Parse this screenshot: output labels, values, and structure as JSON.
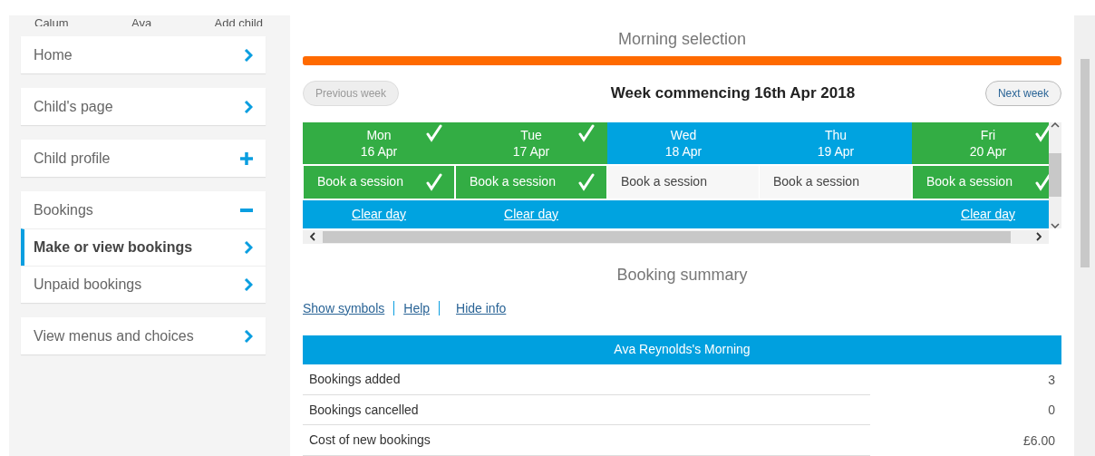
{
  "child_tabs": [
    "Calum",
    "Ava",
    "Add child"
  ],
  "sidebar": {
    "items": [
      {
        "label": "Home",
        "kind": "link",
        "selected": false
      },
      {
        "label": "Child's page",
        "kind": "link",
        "selected": false
      },
      {
        "label": "Child profile",
        "kind": "group",
        "expanded": false,
        "selected": false
      },
      {
        "label": "Bookings",
        "kind": "group",
        "expanded": true,
        "selected": false,
        "children": [
          {
            "label": "Make or view bookings",
            "kind": "link",
            "selected": true
          },
          {
            "label": "Unpaid bookings",
            "kind": "link",
            "selected": false
          }
        ]
      },
      {
        "label": "View menus and choices",
        "kind": "link",
        "selected": false
      }
    ]
  },
  "selection": {
    "title": "Morning selection",
    "level": 1
  },
  "week": {
    "previous": "Previous week",
    "heading": "Week commencing 16th Apr 2018",
    "next": "Next week",
    "previous_disabled": true
  },
  "days": [
    {
      "day": "Mon",
      "date": "16 Apr",
      "booked": true,
      "session": "Book a session",
      "clear": "Clear day"
    },
    {
      "day": "Tue",
      "date": "17 Apr",
      "booked": true,
      "session": "Book a session",
      "clear": "Clear day"
    },
    {
      "day": "Wed",
      "date": "18 Apr",
      "booked": false,
      "session": "Book a session"
    },
    {
      "day": "Thu",
      "date": "19 Apr",
      "booked": false,
      "session": "Book a session"
    },
    {
      "day": "Fri",
      "date": "20 Apr",
      "booked": true,
      "session": "Book a session",
      "clear": "Clear day"
    }
  ],
  "summary": {
    "title": "Booking summary",
    "links": [
      "Show symbols",
      "Help",
      "Hide info"
    ],
    "table_title": "Ava Reynolds's Morning",
    "rows": [
      {
        "label": "Bookings added",
        "value": "3"
      },
      {
        "label": "Bookings cancelled",
        "value": "0"
      },
      {
        "label": "Cost of new bookings",
        "value": "£6.00"
      }
    ]
  }
}
